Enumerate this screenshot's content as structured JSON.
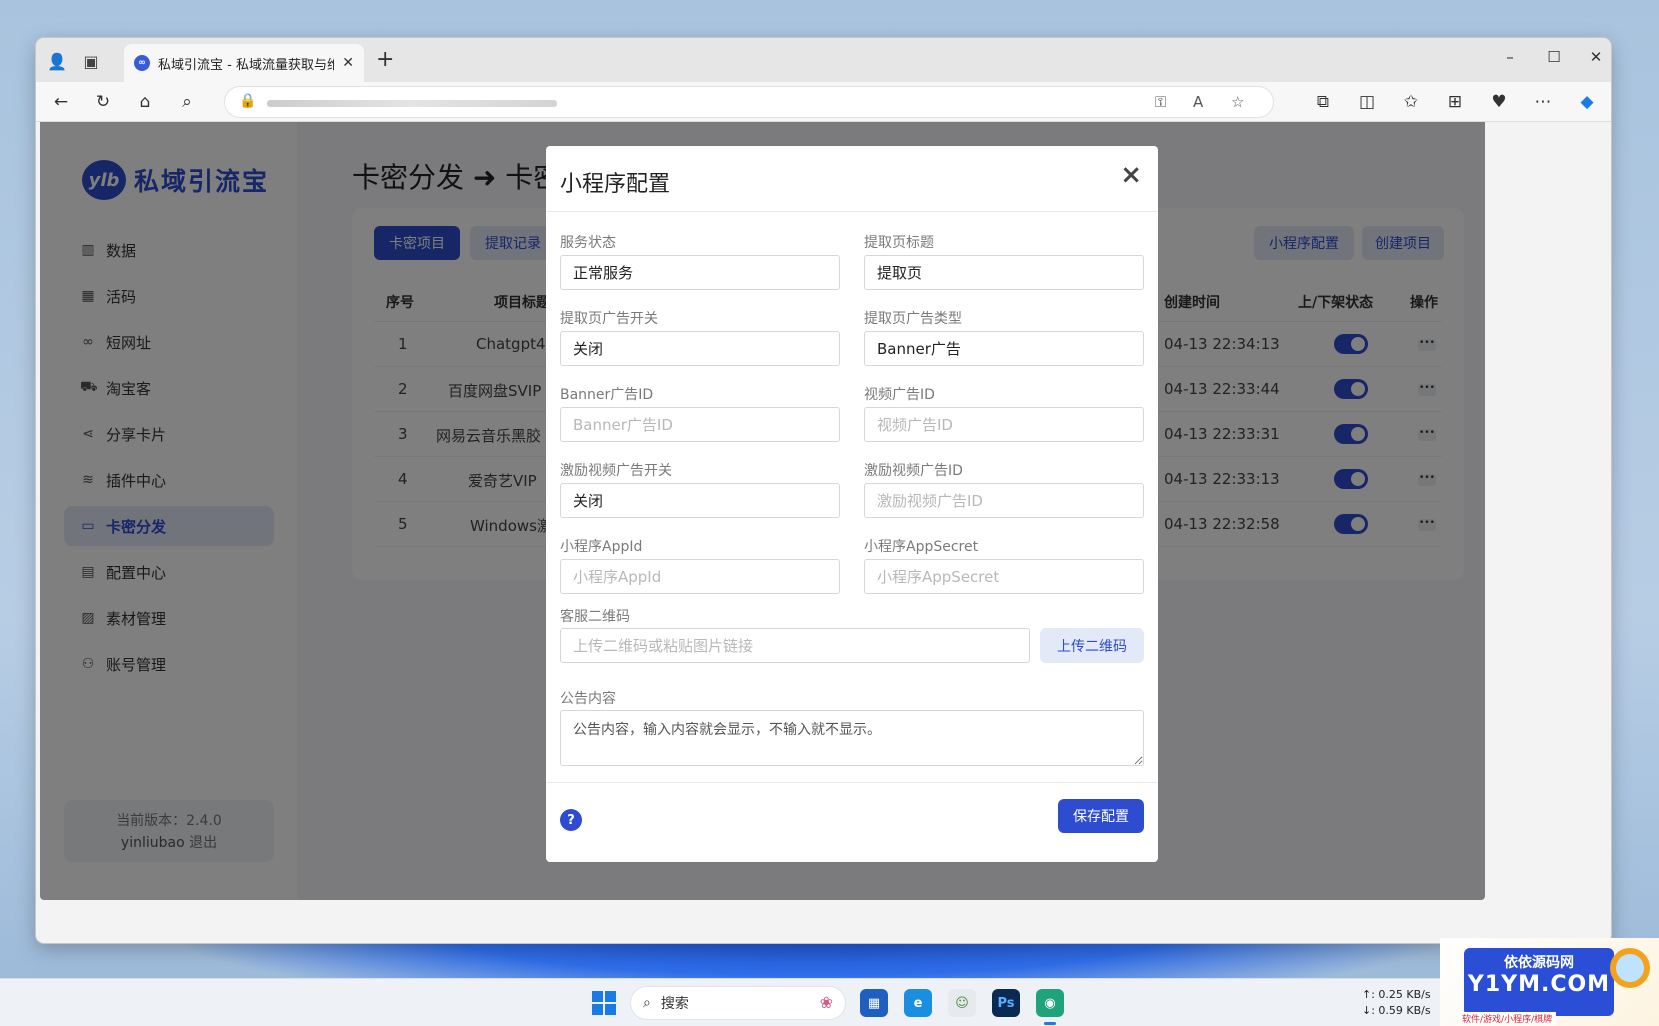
{
  "browser": {
    "tab_title": "私域引流宝 - 私域流量获取与维护",
    "tab_favicon": "ylb-favicon"
  },
  "sidebar": {
    "logo_badge": "ylb",
    "logo_text": "私域引流宝",
    "items": [
      {
        "label": "数据",
        "icon": "chart-icon"
      },
      {
        "label": "活码",
        "icon": "qrcode-icon"
      },
      {
        "label": "短网址",
        "icon": "link-icon"
      },
      {
        "label": "淘宝客",
        "icon": "cart-icon"
      },
      {
        "label": "分享卡片",
        "icon": "share-icon"
      },
      {
        "label": "插件中心",
        "icon": "layers-icon"
      },
      {
        "label": "卡密分发",
        "icon": "card-icon",
        "active": true
      },
      {
        "label": "配置中心",
        "icon": "config-icon"
      },
      {
        "label": "素材管理",
        "icon": "image-icon"
      },
      {
        "label": "账号管理",
        "icon": "user-icon"
      }
    ],
    "version_text": "当前版本：2.4.0",
    "username": "yinliubao",
    "logout_label": "退出"
  },
  "main": {
    "title": "卡密分发 ➜ 卡密",
    "buttons": {
      "card_projects": "卡密项目",
      "extract_records": "提取记录",
      "miniprogram_config": "小程序配置",
      "create_project": "创建项目"
    },
    "table": {
      "headers": [
        "序号",
        "项目标题",
        "创建时间",
        "上/下架状态",
        "操作"
      ],
      "rows": [
        {
          "id": "1",
          "title": "Chatgpt4",
          "created": "04-13 22:34:13"
        },
        {
          "id": "2",
          "title": "百度网盘SVIP",
          "created": "04-13 22:33:44"
        },
        {
          "id": "3",
          "title": "网易云音乐黑胶",
          "created": "04-13 22:33:31"
        },
        {
          "id": "4",
          "title": "爱奇艺VIP",
          "created": "04-13 22:33:13"
        },
        {
          "id": "5",
          "title": "Windows激",
          "created": "04-13 22:32:58"
        }
      ],
      "more_label": "•••"
    }
  },
  "modal": {
    "title": "小程序配置",
    "close": "×",
    "fields": {
      "service_status": {
        "label": "服务状态",
        "value": "正常服务"
      },
      "page_title": {
        "label": "提取页标题",
        "value": "提取页"
      },
      "ad_switch": {
        "label": "提取页广告开关",
        "value": "关闭"
      },
      "ad_type": {
        "label": "提取页广告类型",
        "value": "Banner广告"
      },
      "banner_id": {
        "label": "Banner广告ID",
        "placeholder": "Banner广告ID"
      },
      "video_id": {
        "label": "视频广告ID",
        "placeholder": "视频广告ID"
      },
      "reward_switch": {
        "label": "激励视频广告开关",
        "value": "关闭"
      },
      "reward_id": {
        "label": "激励视频广告ID",
        "placeholder": "激励视频广告ID"
      },
      "appid": {
        "label": "小程序AppId",
        "placeholder": "小程序AppId"
      },
      "appsecret": {
        "label": "小程序AppSecret",
        "placeholder": "小程序AppSecret"
      },
      "qrcode": {
        "label": "客服二维码",
        "placeholder": "上传二维码或粘贴图片链接",
        "button": "上传二维码"
      },
      "notice": {
        "label": "公告内容",
        "placeholder": "公告内容，输入内容就会显示，不输入就不显示。"
      }
    },
    "help": "?",
    "save": "保存配置"
  },
  "taskbar": {
    "search_label": "搜索",
    "net_up": "↑: 0.25 KB/s",
    "net_down": "↓: 0.59 KB/s"
  },
  "watermark": {
    "top": "依依源码网",
    "main": "Y1YM.COM",
    "sub": "软件/游戏/小程序/棋牌"
  },
  "colors": {
    "accent": "#2d4ccf",
    "accent_light": "#e4e9f7"
  }
}
